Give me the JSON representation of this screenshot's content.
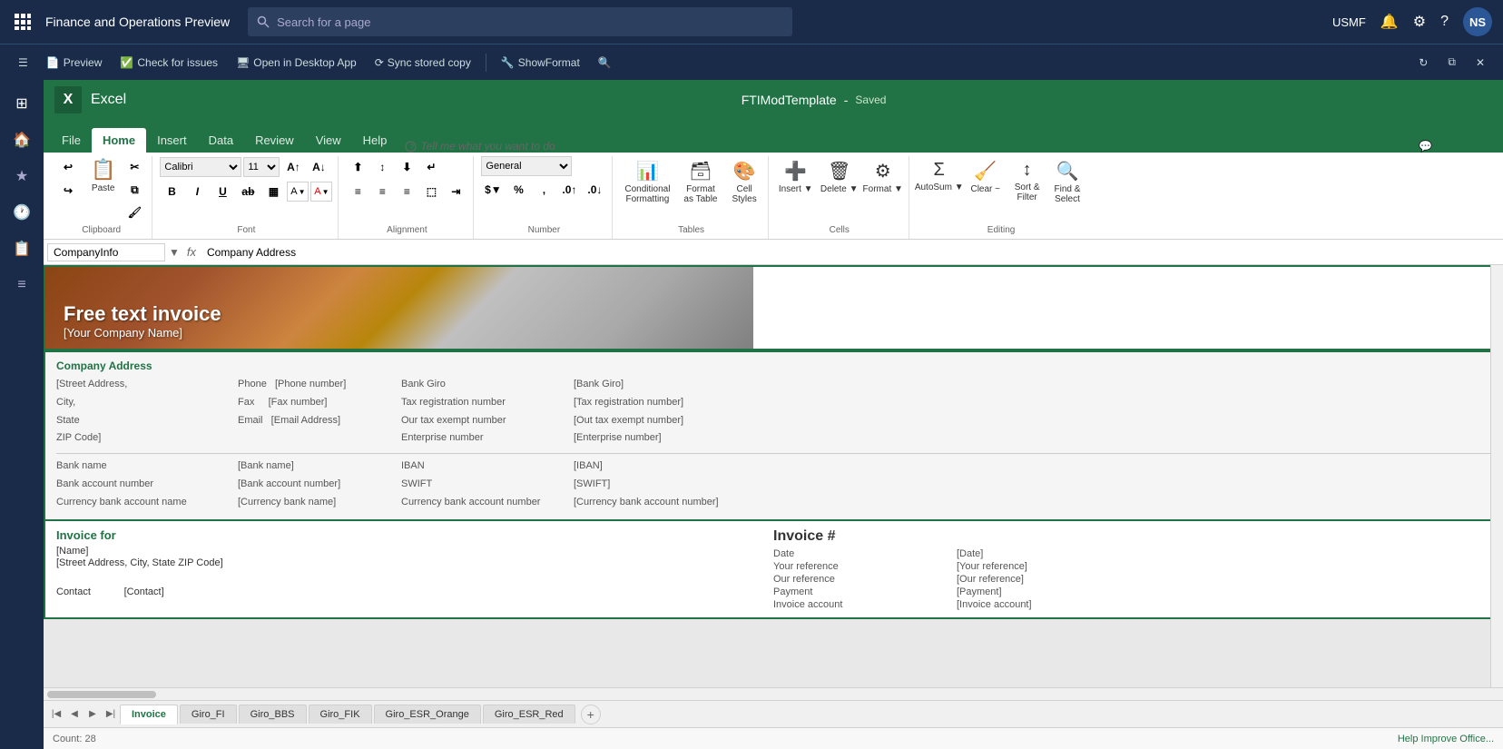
{
  "app": {
    "title": "Finance and Operations Preview",
    "search_placeholder": "Search for a page",
    "user": "USMF",
    "avatar_initials": "NS"
  },
  "second_toolbar": {
    "preview_label": "Preview",
    "check_issues_label": "Check for issues",
    "open_desktop_label": "Open in Desktop App",
    "sync_label": "Sync stored copy",
    "show_format_label": "ShowFormat",
    "refresh_icon": "↻",
    "popout_icon": "⧉",
    "close_icon": "✕"
  },
  "excel": {
    "logo": "X",
    "app_name": "Excel",
    "doc_title": "FTIModTemplate",
    "separator": "-",
    "saved_status": "Saved"
  },
  "ribbon": {
    "tabs": [
      "File",
      "Home",
      "Insert",
      "Data",
      "Review",
      "View",
      "Help"
    ],
    "active_tab": "Home",
    "tell_me": "Tell me what you want to do",
    "comments": "Comments",
    "groups": {
      "clipboard": {
        "label": "Clipboard",
        "undo_icon": "↩",
        "redo_icon": "↪",
        "paste_label": "Paste",
        "cut_icon": "✂",
        "copy_icon": "⧉",
        "format_painter_icon": "🖌"
      },
      "font": {
        "label": "Font",
        "font_name": "Calibri",
        "font_size": "11",
        "bold": "B",
        "italic": "I",
        "underline": "U",
        "strikethrough": "ab",
        "border_icon": "▦",
        "fill_icon": "A",
        "font_color_icon": "A"
      },
      "alignment": {
        "label": "Alignment",
        "icons": [
          "≡",
          "≡",
          "≡",
          "≡",
          "≡",
          "≡",
          "←→",
          "↕"
        ]
      },
      "number": {
        "label": "Number",
        "format": "General",
        "currency": "$",
        "percent": "%",
        "comma": ",",
        "decimal_increase": ".0",
        "decimal_decrease": "0."
      },
      "tables": {
        "label": "Tables",
        "conditional_formatting": "Conditional\nFormatting",
        "format_as_table": "Format\nas Table",
        "cell_styles": "Cell\nStyles"
      },
      "cells": {
        "label": "Cells",
        "insert": "Insert",
        "delete": "Delete",
        "format": "Format"
      },
      "editing": {
        "label": "Editing",
        "autosum": "AutoSum",
        "clear": "Clear ~",
        "sort_filter": "Sort &\nFilter",
        "find_select": "Find &\nSelect"
      }
    }
  },
  "formula_bar": {
    "name_box": "CompanyInfo",
    "formula_value": "Company Address"
  },
  "invoice": {
    "header_title": "Free text invoice",
    "company_placeholder": "[Your Company Name]",
    "company_address_title": "Company Address",
    "address_lines": [
      "[Street Address,",
      "City,",
      "State",
      "ZIP Code]"
    ],
    "phone_label": "Phone",
    "phone_value": "[Phone number]",
    "fax_label": "Fax",
    "fax_value": "[Fax number]",
    "email_label": "Email",
    "email_value": "[Email Address]",
    "bank_giro_label": "Bank Giro",
    "bank_giro_value": "[Bank Giro]",
    "tax_reg_label": "Tax registration number",
    "tax_reg_value": "[Tax registration number]",
    "tax_exempt_label": "Our tax exempt number",
    "tax_exempt_value": "[Out tax exempt number]",
    "enterprise_label": "Enterprise number",
    "enterprise_value": "[Enterprise number]",
    "bank_name_label": "Bank name",
    "bank_name_value": "[Bank name]",
    "bank_account_label": "Bank account number",
    "bank_account_value": "[Bank account number]",
    "bank_currency_label": "Currency bank account name",
    "bank_currency_value": "[Currency bank account number]",
    "iban_label": "IBAN",
    "iban_value": "[IBAN]",
    "swift_label": "SWIFT",
    "swift_value": "[SWIFT]",
    "invoice_for_title": "Invoice for",
    "invoice_for_name": "[Name]",
    "invoice_for_address": "[Street Address, City, State ZIP Code]",
    "contact_label": "Contact",
    "contact_value": "[Contact]",
    "invoice_num_title": "Invoice #",
    "date_label": "Date",
    "date_value": "[Date]",
    "your_ref_label": "Your reference",
    "your_ref_value": "[Your reference]",
    "our_ref_label": "Our reference",
    "our_ref_value": "[Our reference]",
    "payment_label": "Payment",
    "payment_value": "[Payment]",
    "invoice_account_label": "Invoice account",
    "invoice_account_value": "[Invoice account]"
  },
  "sheet_tabs": [
    "Invoice",
    "Giro_FI",
    "Giro_BBS",
    "Giro_FIK",
    "Giro_ESR_Orange",
    "Giro_ESR_Red"
  ],
  "active_sheet": "Invoice",
  "status_bar": {
    "count_label": "Count: 28",
    "help_label": "Help Improve Office..."
  },
  "sidebar": {
    "icons": [
      "⊞",
      "🏠",
      "★",
      "🕐",
      "📋",
      "≡"
    ]
  }
}
